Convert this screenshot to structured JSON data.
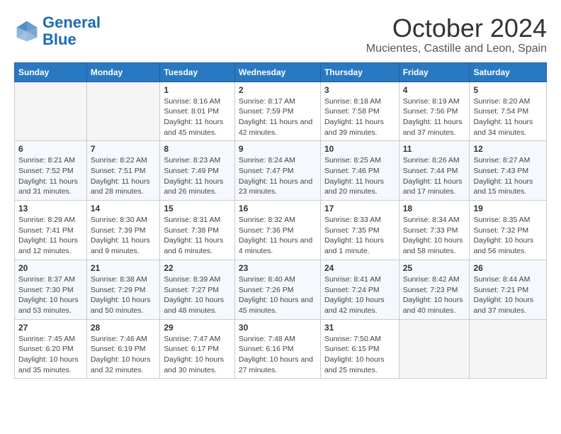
{
  "header": {
    "logo_line1": "General",
    "logo_line2": "Blue",
    "title": "October 2024",
    "subtitle": "Mucientes, Castille and Leon, Spain"
  },
  "calendar": {
    "days_of_week": [
      "Sunday",
      "Monday",
      "Tuesday",
      "Wednesday",
      "Thursday",
      "Friday",
      "Saturday"
    ],
    "weeks": [
      [
        {
          "day": "",
          "info": ""
        },
        {
          "day": "",
          "info": ""
        },
        {
          "day": "1",
          "info": "Sunrise: 8:16 AM\nSunset: 8:01 PM\nDaylight: 11 hours and 45 minutes."
        },
        {
          "day": "2",
          "info": "Sunrise: 8:17 AM\nSunset: 7:59 PM\nDaylight: 11 hours and 42 minutes."
        },
        {
          "day": "3",
          "info": "Sunrise: 8:18 AM\nSunset: 7:58 PM\nDaylight: 11 hours and 39 minutes."
        },
        {
          "day": "4",
          "info": "Sunrise: 8:19 AM\nSunset: 7:56 PM\nDaylight: 11 hours and 37 minutes."
        },
        {
          "day": "5",
          "info": "Sunrise: 8:20 AM\nSunset: 7:54 PM\nDaylight: 11 hours and 34 minutes."
        }
      ],
      [
        {
          "day": "6",
          "info": "Sunrise: 8:21 AM\nSunset: 7:52 PM\nDaylight: 11 hours and 31 minutes."
        },
        {
          "day": "7",
          "info": "Sunrise: 8:22 AM\nSunset: 7:51 PM\nDaylight: 11 hours and 28 minutes."
        },
        {
          "day": "8",
          "info": "Sunrise: 8:23 AM\nSunset: 7:49 PM\nDaylight: 11 hours and 26 minutes."
        },
        {
          "day": "9",
          "info": "Sunrise: 8:24 AM\nSunset: 7:47 PM\nDaylight: 11 hours and 23 minutes."
        },
        {
          "day": "10",
          "info": "Sunrise: 8:25 AM\nSunset: 7:46 PM\nDaylight: 11 hours and 20 minutes."
        },
        {
          "day": "11",
          "info": "Sunrise: 8:26 AM\nSunset: 7:44 PM\nDaylight: 11 hours and 17 minutes."
        },
        {
          "day": "12",
          "info": "Sunrise: 8:27 AM\nSunset: 7:43 PM\nDaylight: 11 hours and 15 minutes."
        }
      ],
      [
        {
          "day": "13",
          "info": "Sunrise: 8:29 AM\nSunset: 7:41 PM\nDaylight: 11 hours and 12 minutes."
        },
        {
          "day": "14",
          "info": "Sunrise: 8:30 AM\nSunset: 7:39 PM\nDaylight: 11 hours and 9 minutes."
        },
        {
          "day": "15",
          "info": "Sunrise: 8:31 AM\nSunset: 7:38 PM\nDaylight: 11 hours and 6 minutes."
        },
        {
          "day": "16",
          "info": "Sunrise: 8:32 AM\nSunset: 7:36 PM\nDaylight: 11 hours and 4 minutes."
        },
        {
          "day": "17",
          "info": "Sunrise: 8:33 AM\nSunset: 7:35 PM\nDaylight: 11 hours and 1 minute."
        },
        {
          "day": "18",
          "info": "Sunrise: 8:34 AM\nSunset: 7:33 PM\nDaylight: 10 hours and 58 minutes."
        },
        {
          "day": "19",
          "info": "Sunrise: 8:35 AM\nSunset: 7:32 PM\nDaylight: 10 hours and 56 minutes."
        }
      ],
      [
        {
          "day": "20",
          "info": "Sunrise: 8:37 AM\nSunset: 7:30 PM\nDaylight: 10 hours and 53 minutes."
        },
        {
          "day": "21",
          "info": "Sunrise: 8:38 AM\nSunset: 7:29 PM\nDaylight: 10 hours and 50 minutes."
        },
        {
          "day": "22",
          "info": "Sunrise: 8:39 AM\nSunset: 7:27 PM\nDaylight: 10 hours and 48 minutes."
        },
        {
          "day": "23",
          "info": "Sunrise: 8:40 AM\nSunset: 7:26 PM\nDaylight: 10 hours and 45 minutes."
        },
        {
          "day": "24",
          "info": "Sunrise: 8:41 AM\nSunset: 7:24 PM\nDaylight: 10 hours and 42 minutes."
        },
        {
          "day": "25",
          "info": "Sunrise: 8:42 AM\nSunset: 7:23 PM\nDaylight: 10 hours and 40 minutes."
        },
        {
          "day": "26",
          "info": "Sunrise: 8:44 AM\nSunset: 7:21 PM\nDaylight: 10 hours and 37 minutes."
        }
      ],
      [
        {
          "day": "27",
          "info": "Sunrise: 7:45 AM\nSunset: 6:20 PM\nDaylight: 10 hours and 35 minutes."
        },
        {
          "day": "28",
          "info": "Sunrise: 7:46 AM\nSunset: 6:19 PM\nDaylight: 10 hours and 32 minutes."
        },
        {
          "day": "29",
          "info": "Sunrise: 7:47 AM\nSunset: 6:17 PM\nDaylight: 10 hours and 30 minutes."
        },
        {
          "day": "30",
          "info": "Sunrise: 7:48 AM\nSunset: 6:16 PM\nDaylight: 10 hours and 27 minutes."
        },
        {
          "day": "31",
          "info": "Sunrise: 7:50 AM\nSunset: 6:15 PM\nDaylight: 10 hours and 25 minutes."
        },
        {
          "day": "",
          "info": ""
        },
        {
          "day": "",
          "info": ""
        }
      ]
    ]
  }
}
